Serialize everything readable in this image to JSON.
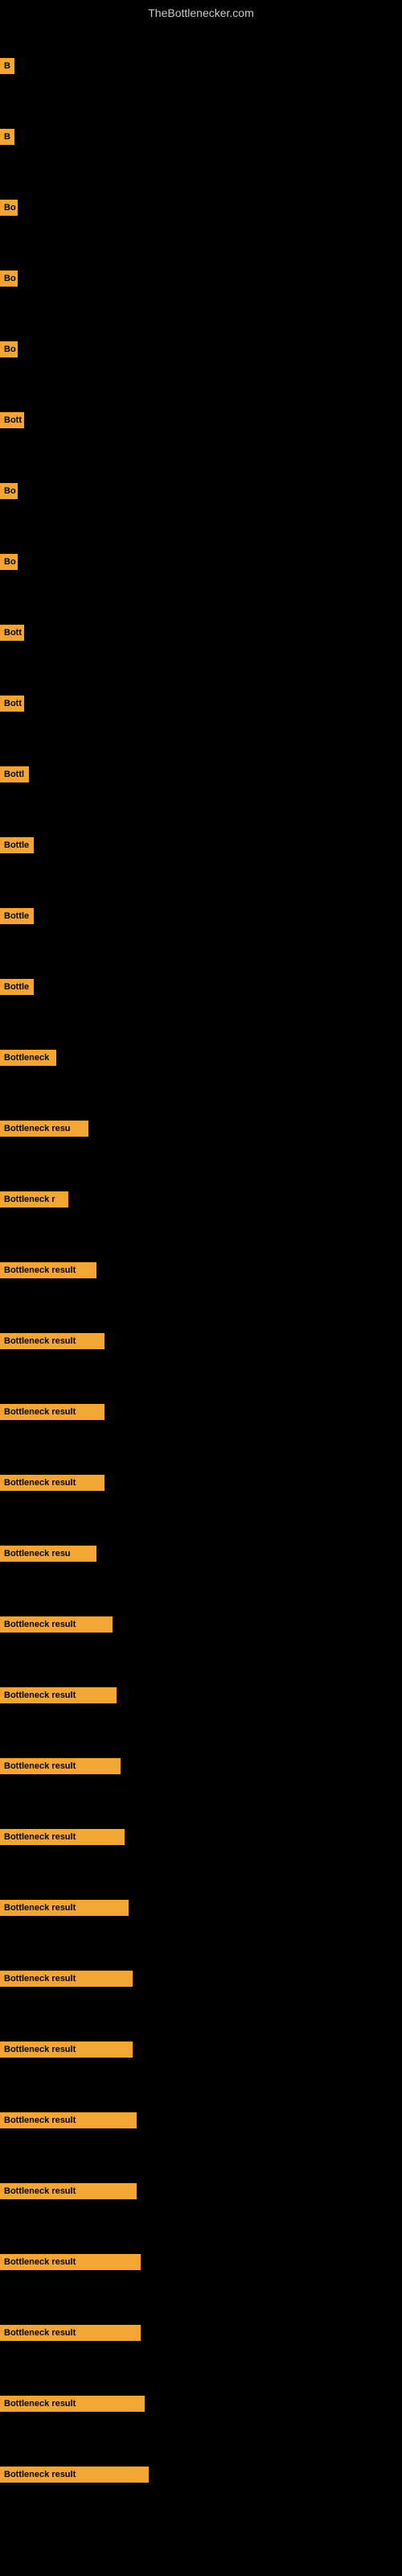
{
  "site": {
    "title": "TheBottlenecker.com"
  },
  "bars": [
    {
      "id": 1,
      "label": "B",
      "width": 18
    },
    {
      "id": 2,
      "label": "B",
      "width": 18
    },
    {
      "id": 3,
      "label": "Bo",
      "width": 22
    },
    {
      "id": 4,
      "label": "Bo",
      "width": 22
    },
    {
      "id": 5,
      "label": "Bo",
      "width": 22
    },
    {
      "id": 6,
      "label": "Bott",
      "width": 30
    },
    {
      "id": 7,
      "label": "Bo",
      "width": 22
    },
    {
      "id": 8,
      "label": "Bo",
      "width": 22
    },
    {
      "id": 9,
      "label": "Bott",
      "width": 30
    },
    {
      "id": 10,
      "label": "Bott",
      "width": 30
    },
    {
      "id": 11,
      "label": "Bottl",
      "width": 36
    },
    {
      "id": 12,
      "label": "Bottle",
      "width": 42
    },
    {
      "id": 13,
      "label": "Bottle",
      "width": 42
    },
    {
      "id": 14,
      "label": "Bottle",
      "width": 42
    },
    {
      "id": 15,
      "label": "Bottleneck",
      "width": 70
    },
    {
      "id": 16,
      "label": "Bottleneck resu",
      "width": 110
    },
    {
      "id": 17,
      "label": "Bottleneck r",
      "width": 85
    },
    {
      "id": 18,
      "label": "Bottleneck result",
      "width": 120
    },
    {
      "id": 19,
      "label": "Bottleneck result",
      "width": 130
    },
    {
      "id": 20,
      "label": "Bottleneck result",
      "width": 130
    },
    {
      "id": 21,
      "label": "Bottleneck result",
      "width": 130
    },
    {
      "id": 22,
      "label": "Bottleneck resu",
      "width": 120
    },
    {
      "id": 23,
      "label": "Bottleneck result",
      "width": 140
    },
    {
      "id": 24,
      "label": "Bottleneck result",
      "width": 145
    },
    {
      "id": 25,
      "label": "Bottleneck result",
      "width": 150
    },
    {
      "id": 26,
      "label": "Bottleneck result",
      "width": 155
    },
    {
      "id": 27,
      "label": "Bottleneck result",
      "width": 160
    },
    {
      "id": 28,
      "label": "Bottleneck result",
      "width": 165
    },
    {
      "id": 29,
      "label": "Bottleneck result",
      "width": 165
    },
    {
      "id": 30,
      "label": "Bottleneck result",
      "width": 170
    },
    {
      "id": 31,
      "label": "Bottleneck result",
      "width": 170
    },
    {
      "id": 32,
      "label": "Bottleneck result",
      "width": 175
    },
    {
      "id": 33,
      "label": "Bottleneck result",
      "width": 175
    },
    {
      "id": 34,
      "label": "Bottleneck result",
      "width": 180
    },
    {
      "id": 35,
      "label": "Bottleneck result",
      "width": 185
    }
  ]
}
